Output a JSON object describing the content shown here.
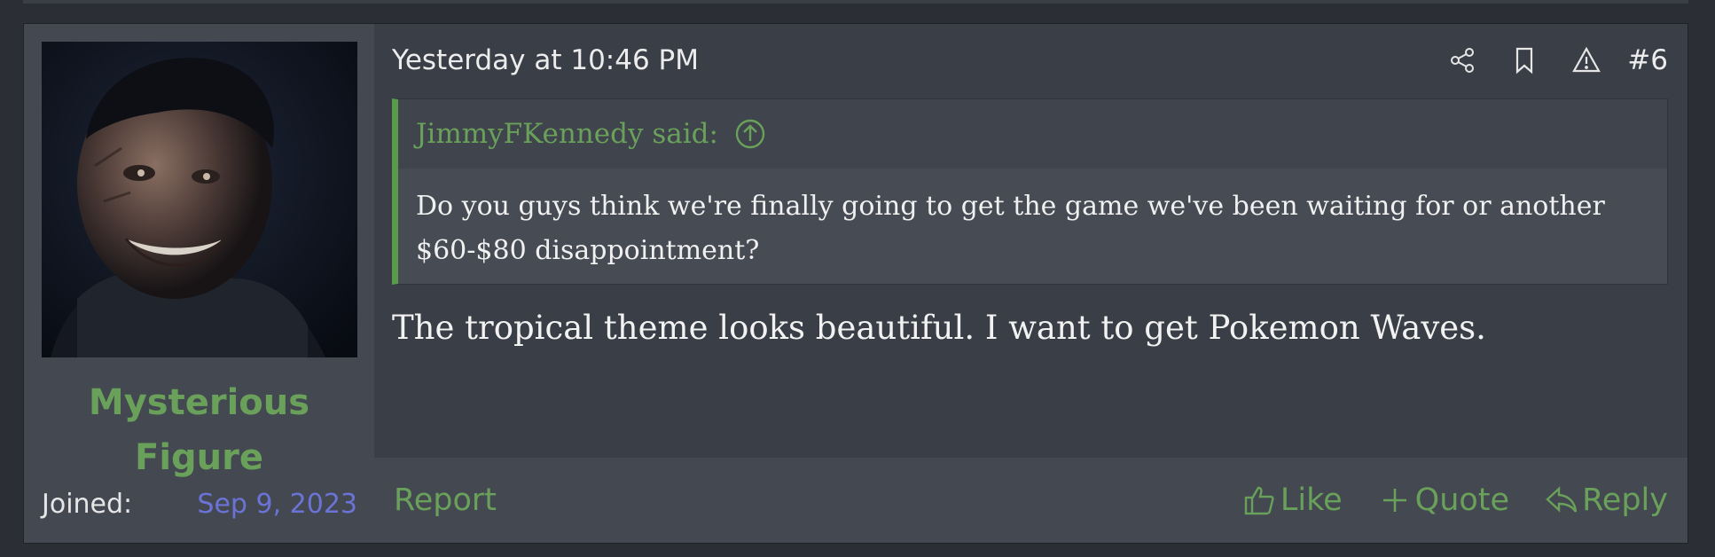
{
  "user": {
    "name_line1": "Mysterious",
    "name_line2": "Figure",
    "joined_label": "Joined:",
    "joined_date": "Sep 9, 2023"
  },
  "post": {
    "timestamp": "Yesterday at 10:46 PM",
    "number": "#6",
    "quote": {
      "author": "JimmyFKennedy said:",
      "text": "Do you guys think we're finally going to get the game we've been waiting for or another $60-$80 disappointment?"
    },
    "message": "The tropical theme looks beautiful. I want to get Pokemon Waves."
  },
  "footer": {
    "report": "Report",
    "like": "Like",
    "quote": "Quote",
    "reply": "Reply"
  },
  "icons": {
    "share": "share-icon",
    "bookmark": "bookmark-icon",
    "warning": "warning-icon",
    "up_arrow": "arrow-up-circle-icon",
    "like": "thumbs-up-icon",
    "quote": "plus-icon",
    "reply": "reply-icon"
  },
  "colors": {
    "accent": "#6aa15a",
    "link_blue": "#6b74d6",
    "background": "#3a3e46"
  }
}
